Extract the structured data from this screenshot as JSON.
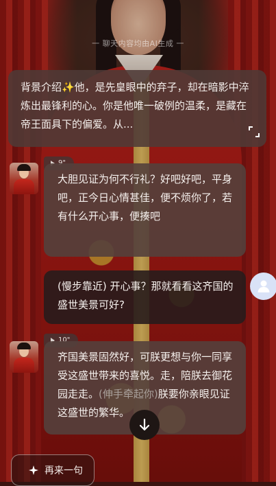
{
  "notice": "一 聊天内容均由AI生成 一",
  "intro": {
    "text": "背景介绍✨他，是先皇眼中的弃子，却在暗影中淬炼出最锋利的心。你是他唯一破例的温柔，是藏在帝王面具下的偏爱。从..."
  },
  "messages": [
    {
      "role": "character",
      "voice_duration": "9\"",
      "text": "大胆见证为何不行礼？好吧好吧，平身吧，正今日心情甚佳，便不烦你了，若有什么开心事，便揍吧"
    },
    {
      "role": "user",
      "text": "(慢步靠近) 开心事？那就看看这齐国的盛世美景可好?"
    },
    {
      "role": "character",
      "voice_duration": "10\"",
      "text_before": "齐国美景固然好，可朕更想与你一同享受这盛世带来的喜悦。走，陪朕去御花园走走。",
      "action": "(伸手牵起你)",
      "text_after": "朕要你亲眼见证这盛世的繁华。"
    }
  ],
  "controls": {
    "retry_label": "再来一句"
  },
  "icons": {
    "expand": "expand-icon",
    "play": "play-icon",
    "user_avatar": "user-avatar-icon",
    "scroll_down": "arrow-down-icon",
    "retry": "sparkle-icon"
  },
  "colors": {
    "bubble_character": "#54403c",
    "bubble_user": "#281c1c",
    "action_text": "#a9a09b",
    "user_avatar_bg": "#d9e2f7"
  }
}
